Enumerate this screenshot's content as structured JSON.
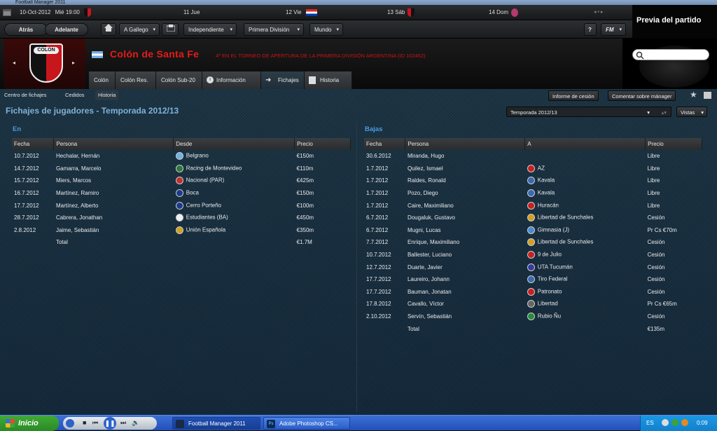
{
  "window": {
    "title": "Football Manager 2011"
  },
  "calendar": {
    "current_date": "10-Oct-2012",
    "current_day": "Mié 19:00",
    "days": [
      {
        "label": "11 Jue"
      },
      {
        "label": "12 Vie"
      },
      {
        "label": "13 Sáb"
      },
      {
        "label": "14 Dom"
      }
    ]
  },
  "nav": {
    "back": "Atrás",
    "forward": "Adelante",
    "menus": [
      "A Gallego",
      "Independiente",
      "Primera División",
      "Mundo"
    ],
    "help": "?",
    "fm": "FM"
  },
  "preview": {
    "label": "Previa del partido"
  },
  "club": {
    "crest_text": "COLON",
    "name": "Colón de Santa Fe",
    "subtitle": "4º EN EL TORNEO DE APERTURA DE LA PRIMERA DIVISIÓN ARGENTINA (ID 102462)",
    "tabs": [
      "Colón",
      "Colón Res.",
      "Colón Sub-20",
      "Información",
      "Fichajes",
      "Historia"
    ],
    "active_tab": "Fichajes"
  },
  "subnav": {
    "links": [
      "Centro de fichajes",
      "Cedidos",
      "Historia"
    ],
    "active": "Historia",
    "buttons": [
      "Informe de cesión",
      "Comentar sobre mánager"
    ]
  },
  "page": {
    "title": "Fichajes de jugadores - Temporada 2012/13",
    "season_select": "Temporada 2012/13",
    "views": "Vistas"
  },
  "ins": {
    "heading": "En",
    "columns": [
      "Fecha",
      "Persona",
      "Desde",
      "Precio"
    ],
    "rows": [
      {
        "date": "10.7.2012",
        "person": "Hechalar, Hernán",
        "club": "Belgrano",
        "price": "€150m"
      },
      {
        "date": "14.7.2012",
        "person": "Gamarra, Marcelo",
        "club": "Racing de Montevideo",
        "price": "€110m"
      },
      {
        "date": "15.7.2012",
        "person": "Miers, Marcos",
        "club": "Nacional (PAR)",
        "price": "€425m"
      },
      {
        "date": "16.7.2012",
        "person": "Martínez, Ramiro",
        "club": "Boca",
        "price": "€150m"
      },
      {
        "date": "17.7.2012",
        "person": "Martínez, Alberto",
        "club": "Cerro Porteño",
        "price": "€100m"
      },
      {
        "date": "28.7.2012",
        "person": "Cabrera, Jonathan",
        "club": "Estudiantes (BA)",
        "price": "€450m"
      },
      {
        "date": "2.8.2012",
        "person": "Jaime, Sebastián",
        "club": "Unión Española",
        "price": "€350m"
      }
    ],
    "total_label": "Total",
    "total_value": "€1.7M"
  },
  "outs": {
    "heading": "Bajas",
    "columns": [
      "Fecha",
      "Persona",
      "A",
      "Precio"
    ],
    "rows": [
      {
        "date": "30.6.2012",
        "person": "Miranda, Hugo",
        "club": "",
        "price": "Libre"
      },
      {
        "date": "1.7.2012",
        "person": "Quilez, Ismael",
        "club": "AZ",
        "price": "Libre"
      },
      {
        "date": "1.7.2012",
        "person": "Raldes, Ronald",
        "club": "Kavala",
        "price": "Libre"
      },
      {
        "date": "1.7.2012",
        "person": "Pozo, Diego",
        "club": "Kavala",
        "price": "Libre"
      },
      {
        "date": "1.7.2012",
        "person": "Caire, Maximiliano",
        "club": "Huracán",
        "price": "Libre"
      },
      {
        "date": "6.7.2012",
        "person": "Dougaluk, Gustavo",
        "club": "Libertad de Sunchales",
        "price": "Cesión"
      },
      {
        "date": "6.7.2012",
        "person": "Mugni, Lucas",
        "club": "Gimnasia (J)",
        "price": "Pr Cs €70m"
      },
      {
        "date": "7.7.2012",
        "person": "Enrique, Maximiliano",
        "club": "Libertad de Sunchales",
        "price": "Cesión"
      },
      {
        "date": "10.7.2012",
        "person": "Ballester, Luciano",
        "club": "9 de Julio",
        "price": "Cesión"
      },
      {
        "date": "12.7.2012",
        "person": "Duarte, Javier",
        "club": "UTA Tucumán",
        "price": "Cesión"
      },
      {
        "date": "17.7.2012",
        "person": "Laureiro, Johann",
        "club": "Tiro Federal",
        "price": "Cesión"
      },
      {
        "date": "17.7.2012",
        "person": "Bauman, Jonatan",
        "club": "Patronato",
        "price": "Cesión"
      },
      {
        "date": "17.8.2012",
        "person": "Cavallo, Víctor",
        "club": "Libertad",
        "price": "Pr Cs €65m"
      },
      {
        "date": "2.10.2012",
        "person": "Servín, Sebastián",
        "club": "Rubio Ñu",
        "price": "Cesión"
      }
    ],
    "total_label": "Total",
    "total_value": "€135m"
  },
  "taskbar": {
    "start": "Inicio",
    "tasks": [
      "Football Manager 2011",
      "Adobe Photoshop CS..."
    ],
    "lang": "ES",
    "clock": "0:09"
  },
  "colors": {
    "accent_title": "#7fb2d8",
    "club_red": "#e81a1a",
    "panel_heading": "#4a9be0"
  }
}
